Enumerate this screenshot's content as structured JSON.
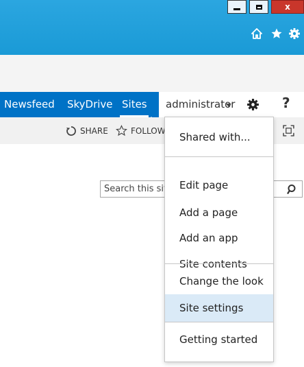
{
  "window": {
    "minimize_icon": "minimize-icon",
    "maximize_icon": "maximize-icon",
    "close_label": "x",
    "close_color": "#c9362b",
    "toolbar_icons": [
      "home-icon",
      "star-icon",
      "gear-icon"
    ]
  },
  "suite_nav": {
    "background": "#0072c6",
    "links": [
      "Newsfeed",
      "SkyDrive",
      "Sites"
    ],
    "active": "Sites",
    "user": "administrator",
    "settings_icon": "gear-icon",
    "help_label": "?"
  },
  "ribbon": {
    "share_label": "SHARE",
    "follow_label": "FOLLOW",
    "focus_icon": "focus-on-content-icon"
  },
  "search": {
    "placeholder": "Search this site"
  },
  "menu": {
    "items": [
      "Shared with...",
      "Edit page",
      "Add a page",
      "Add an app",
      "Site contents",
      "Change the look",
      "Site settings",
      "Getting started"
    ],
    "highlighted": "Site settings",
    "highlight_color": "#daeaf7"
  }
}
